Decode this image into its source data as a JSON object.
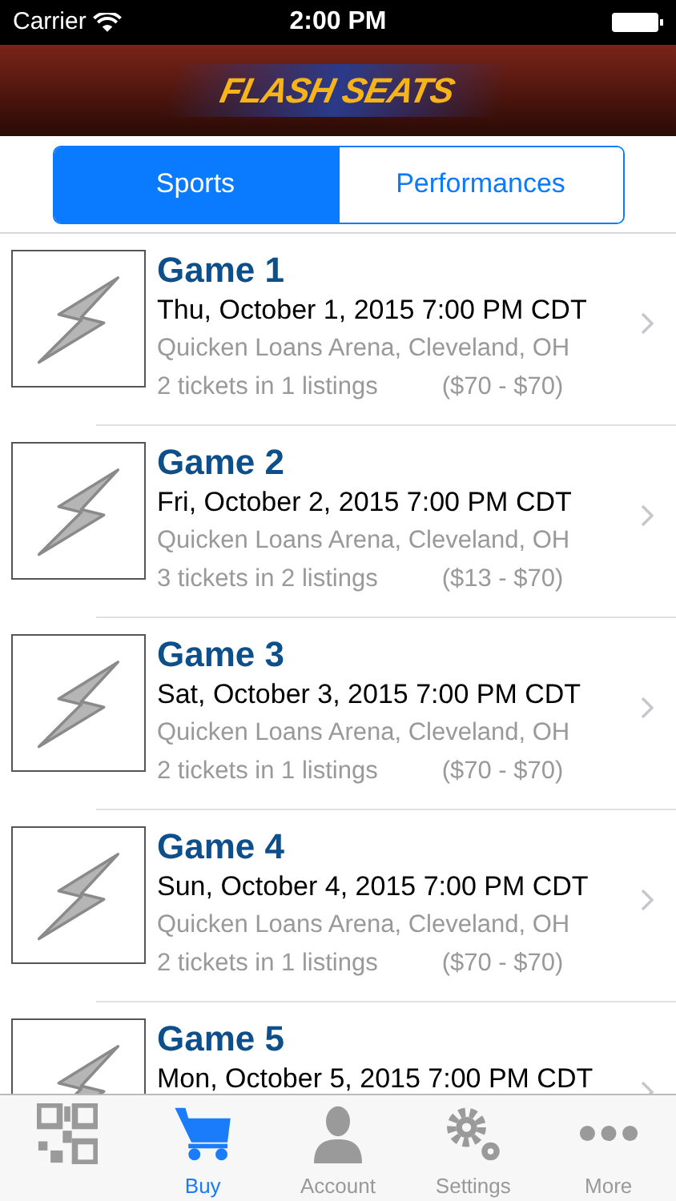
{
  "status_bar": {
    "carrier": "Carrier",
    "time": "2:00 PM"
  },
  "header": {
    "logo": "FLASH SEATS"
  },
  "segments": [
    {
      "label": "Sports",
      "selected": true
    },
    {
      "label": "Performances",
      "selected": false
    }
  ],
  "events": [
    {
      "title": "Game 1",
      "date": "Thu, October 1, 2015 7:00 PM CDT",
      "venue": "Quicken Loans Arena, Cleveland, OH",
      "tickets": "2 tickets in 1 listings",
      "price": "($70 - $70)"
    },
    {
      "title": "Game 2",
      "date": "Fri, October 2, 2015 7:00 PM CDT",
      "venue": "Quicken Loans Arena, Cleveland, OH",
      "tickets": "3 tickets in 2 listings",
      "price": "($13 - $70)"
    },
    {
      "title": "Game 3",
      "date": "Sat, October 3, 2015 7:00 PM CDT",
      "venue": "Quicken Loans Arena, Cleveland, OH",
      "tickets": "2 tickets in 1 listings",
      "price": "($70 - $70)"
    },
    {
      "title": "Game 4",
      "date": "Sun, October 4, 2015 7:00 PM CDT",
      "venue": "Quicken Loans Arena, Cleveland, OH",
      "tickets": "2 tickets in 1 listings",
      "price": "($70 - $70)"
    },
    {
      "title": "Game 5",
      "date": "Mon, October 5, 2015 7:00 PM CDT"
    }
  ],
  "tab_bar": [
    {
      "kind": "scan",
      "selected": false
    },
    {
      "kind": "buy",
      "label": "Buy",
      "selected": true
    },
    {
      "kind": "account",
      "label": "Account",
      "selected": false
    },
    {
      "kind": "settings",
      "label": "Settings",
      "selected": false
    },
    {
      "kind": "more",
      "label": "More",
      "selected": false
    }
  ]
}
